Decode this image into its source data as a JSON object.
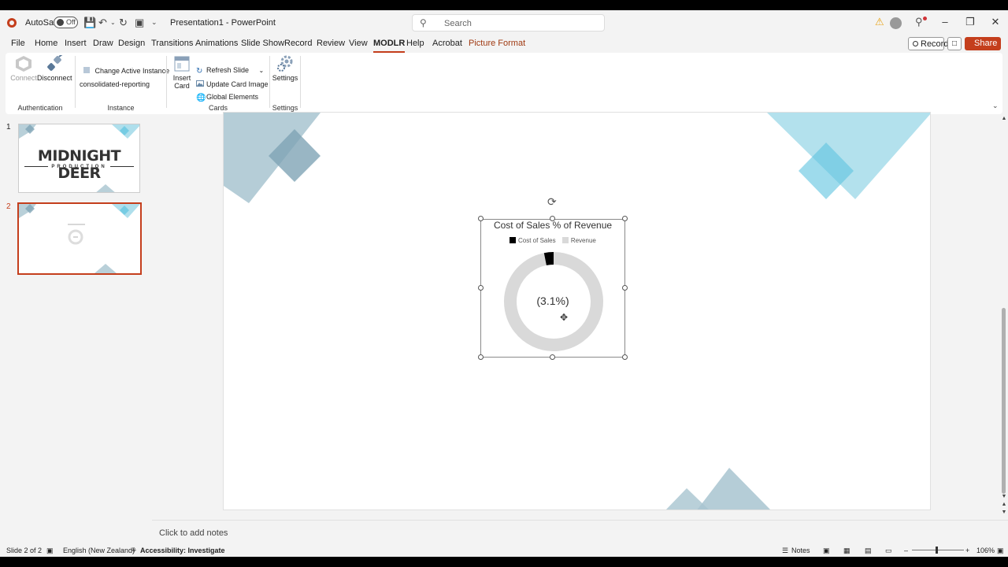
{
  "titlebar": {
    "autosave_label": "AutoSave",
    "autosave_state": "Off",
    "doc_title": "Presentation1 - PowerPoint",
    "search_placeholder": "Search"
  },
  "menu": {
    "tabs": [
      "File",
      "Home",
      "Insert",
      "Draw",
      "Design",
      "Transitions",
      "Animations",
      "Slide Show",
      "Record",
      "Review",
      "View",
      "MODLR",
      "Help",
      "Acrobat",
      "Picture Format"
    ],
    "active_tab": "MODLR",
    "record_label": "Record",
    "share_label": "Share"
  },
  "ribbon": {
    "authentication": {
      "group_label": "Authentication",
      "connect_label": "Connect",
      "disconnect_label": "Disconnect"
    },
    "instance": {
      "group_label": "Instance",
      "change_label": "Change Active Instance",
      "instance_name": "consolidated-reporting"
    },
    "cards": {
      "group_label": "Cards",
      "insert_card_line1": "Insert",
      "insert_card_line2": "Card",
      "refresh_label": "Refresh Slide",
      "update_label": "Update Card Image",
      "global_label": "Global Elements"
    },
    "settings": {
      "group_label": "Settings",
      "settings_label": "Settings"
    }
  },
  "thumbnails": [
    {
      "number": "1",
      "title": "MIDNIGHT DEER",
      "subtitle": "PRODUCTION"
    },
    {
      "number": "2"
    }
  ],
  "chart_data": {
    "type": "pie",
    "title": "Cost of Sales  % of Revenue",
    "legend": [
      "Cost of Sales",
      "Revenue"
    ],
    "categories": [
      "Cost of Sales",
      "Revenue"
    ],
    "values": [
      3.1,
      96.9
    ],
    "center_label": "(3.1%)",
    "colors": {
      "cost_of_sales": "#000000",
      "revenue": "#d9d9d9"
    }
  },
  "notes_placeholder": "Click to add notes",
  "statusbar": {
    "slide_info": "Slide 2 of 2",
    "language": "English (New Zealand)",
    "accessibility": "Accessibility: Investigate",
    "notes_label": "Notes",
    "zoom": "106%"
  }
}
